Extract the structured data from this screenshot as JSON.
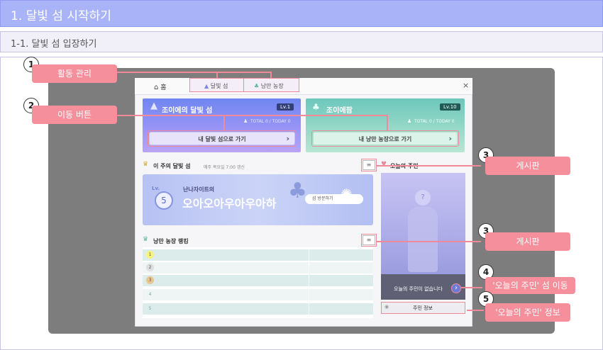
{
  "heading1": "1. 달빛 섬 시작하기",
  "heading2": "1-1. 달빛 섬 입장하기",
  "window": {
    "home_label": "홈",
    "close": "×",
    "tabs": [
      {
        "label": "달빛 섬"
      },
      {
        "label": "낭만 농장"
      }
    ],
    "card1": {
      "title": "조이에의 달빛 섬",
      "level": "Lv.1",
      "stats": "TOTAL 0 / TODAY 0",
      "button": "내 달빛 섬으로 가기",
      "arrow": "›"
    },
    "card2": {
      "title": "조이에팜",
      "level": "Lv.10",
      "stats": "TOTAL 0 / TODAY 0",
      "button": "내 낭만 농장으로 가기",
      "arrow": "›"
    },
    "weekly": {
      "title": "이 주의 달빛 섬",
      "note": "매주 목요일 7:00 갱신",
      "banner_level_prefix": "Lv.",
      "banner_level": "5",
      "banner_owner": "난나자이트의",
      "banner_name": "오아오아우아우아하",
      "banner_button": "섬 방문하기"
    },
    "ranking": {
      "title": "낭만 농장 랭킹",
      "rows": [
        "1",
        "2",
        "3",
        "4",
        "5"
      ]
    },
    "today": {
      "title": "오늘의 주민",
      "empty": "오늘의 주민이 없습니다",
      "question": "?",
      "info_button": "주민 정보"
    }
  },
  "callouts": [
    {
      "num": "1",
      "label": "활동 관리"
    },
    {
      "num": "2",
      "label": "이동 버튼"
    },
    {
      "num": "3",
      "label": "게시판"
    },
    {
      "num": "3",
      "label": "게시판"
    },
    {
      "num": "4",
      "label": "'오늘의 주민' 섬 이동"
    },
    {
      "num": "5",
      "label": "'오늘의 주민' 정보"
    }
  ],
  "colors": {
    "accent_pink": "#f58f9b",
    "header_blue": "#a9b3f7",
    "card_blue": "#7c8bf2",
    "card_green": "#7fcfc1"
  }
}
